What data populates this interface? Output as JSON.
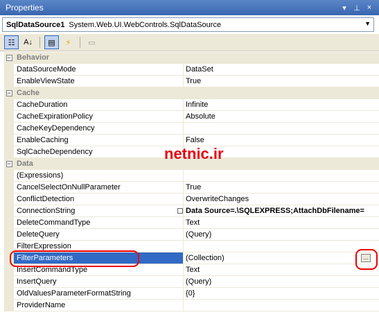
{
  "window": {
    "title": "Properties",
    "buttons": [
      "▾",
      "⊥",
      "×"
    ]
  },
  "object_selector": {
    "name": "SqlDataSource1",
    "type": "System.Web.UI.WebControls.SqlDataSource"
  },
  "toolbar": {
    "buttons": [
      "categorized",
      "alphabetical",
      "properties",
      "events",
      "property-pages"
    ]
  },
  "watermark": "netnic.ir",
  "categories": [
    {
      "name": "Behavior",
      "rows": [
        {
          "name": "DataSourceMode",
          "value": "DataSet"
        },
        {
          "name": "EnableViewState",
          "value": "True"
        }
      ]
    },
    {
      "name": "Cache",
      "rows": [
        {
          "name": "CacheDuration",
          "value": "Infinite"
        },
        {
          "name": "CacheExpirationPolicy",
          "value": "Absolute"
        },
        {
          "name": "CacheKeyDependency",
          "value": ""
        },
        {
          "name": "EnableCaching",
          "value": "False"
        },
        {
          "name": "SqlCacheDependency",
          "value": ""
        }
      ]
    },
    {
      "name": "Data",
      "rows": [
        {
          "name": "(Expressions)",
          "value": ""
        },
        {
          "name": "CancelSelectOnNullParameter",
          "value": "True"
        },
        {
          "name": "ConflictDetection",
          "value": "OverwriteChanges"
        },
        {
          "name": "ConnectionString",
          "value": "Data Source=.\\SQLEXPRESS;AttachDbFilename="
        },
        {
          "name": "DeleteCommandType",
          "value": "Text"
        },
        {
          "name": "DeleteQuery",
          "value": "(Query)"
        },
        {
          "name": "FilterExpression",
          "value": ""
        },
        {
          "name": "FilterParameters",
          "value": "(Collection)"
        },
        {
          "name": "InsertCommandType",
          "value": "Text"
        },
        {
          "name": "InsertQuery",
          "value": "(Query)"
        },
        {
          "name": "OldValuesParameterFormatString",
          "value": "{0}"
        },
        {
          "name": "ProviderName",
          "value": ""
        }
      ]
    }
  ]
}
